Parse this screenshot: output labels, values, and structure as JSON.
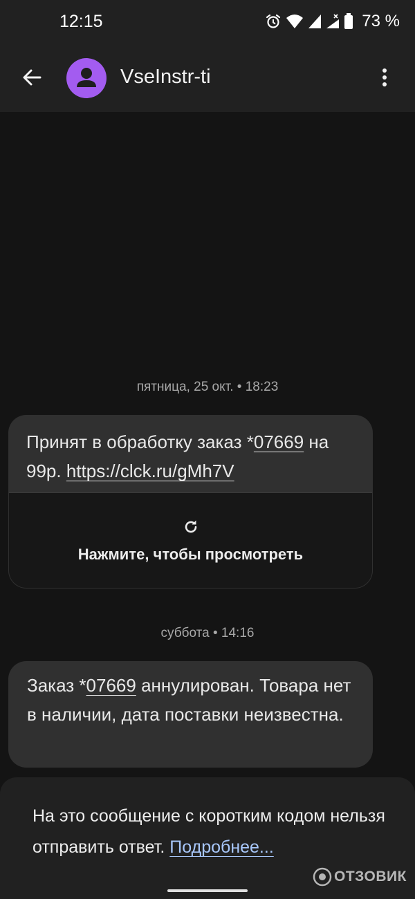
{
  "status_bar": {
    "time": "12:15",
    "battery_percent": "73 %",
    "icons": [
      "alarm-icon",
      "wifi-icon",
      "signal-icon",
      "signal-no-data-icon",
      "battery-icon"
    ]
  },
  "app_bar": {
    "contact_name": "VseInstr-ti",
    "avatar_color": "#a35cf0",
    "icons": [
      "back-arrow-icon",
      "person-icon",
      "more-vert-icon"
    ]
  },
  "thread": {
    "messages": [
      {
        "timestamp": "пятница, 25 окт. • 18:23",
        "text_before": "Принят в обработку заказ *",
        "order_number": "07669",
        "text_middle": " на 99р. ",
        "link": "https://clck.ru/gMh7V",
        "preview": {
          "icon": "refresh-icon",
          "label": "Нажмите, чтобы просмотреть"
        }
      },
      {
        "timestamp": "суббота • 14:16",
        "text_before": "Заказ *",
        "order_number": "07669",
        "text_after": " аннулирован. Товара нет в наличии, дата поставки неизвестна."
      }
    ]
  },
  "notice": {
    "text": "На это сообщение с коротким кодом нельзя отправить ответ. ",
    "link": "Подробнее..."
  },
  "watermark": {
    "text": "ОТЗОВИК"
  },
  "colors": {
    "background": "#141414",
    "bar": "#212121",
    "bubble": "#303030",
    "link": "#a8c7fa"
  }
}
